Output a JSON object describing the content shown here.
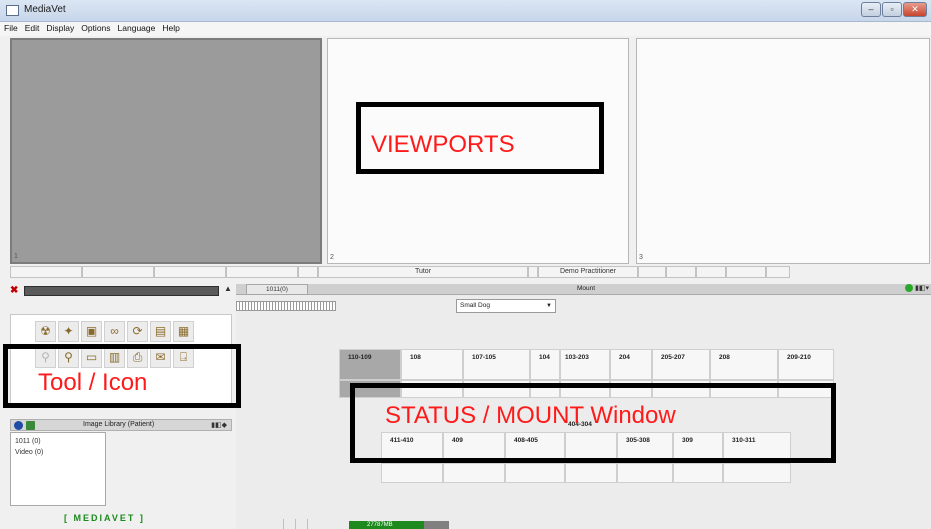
{
  "window": {
    "title": "MediaVet",
    "buttons": {
      "minimize": "–",
      "maximize": "▫",
      "close": "✕"
    }
  },
  "menu": [
    "File",
    "Edit",
    "Display",
    "Options",
    "Language",
    "Help"
  ],
  "viewports": {
    "numbers": [
      "1",
      "2",
      "3"
    ]
  },
  "status_strip": [
    "",
    "",
    "",
    "",
    "",
    "Tutor",
    "",
    "Demo Practitioner",
    "",
    "",
    "",
    "",
    "",
    "",
    ""
  ],
  "tools": {
    "row1": [
      {
        "icon": "radiation-icon",
        "glyph": "☢",
        "enabled": true
      },
      {
        "icon": "wand-icon",
        "glyph": "✦",
        "enabled": true
      },
      {
        "icon": "image-tool-icon",
        "glyph": "▣",
        "enabled": true
      },
      {
        "icon": "link-icon",
        "glyph": "∞",
        "enabled": true
      },
      {
        "icon": "refresh-icon",
        "glyph": "⟳",
        "enabled": true
      },
      {
        "icon": "save-icon",
        "glyph": "▤",
        "enabled": true
      },
      {
        "icon": "layout-icon",
        "glyph": "▦",
        "enabled": true
      }
    ],
    "row2": [
      {
        "icon": "zoom-out-icon",
        "glyph": "⚲",
        "enabled": false
      },
      {
        "icon": "zoom-icon",
        "glyph": "⚲",
        "enabled": true
      },
      {
        "icon": "document-icon",
        "glyph": "▭",
        "enabled": true
      },
      {
        "icon": "print-preview-icon",
        "glyph": "▥",
        "enabled": true
      },
      {
        "icon": "printer-icon",
        "glyph": "⎙",
        "enabled": true
      },
      {
        "icon": "send-icon",
        "glyph": "✉",
        "enabled": true
      },
      {
        "icon": "exit-door-icon",
        "glyph": "⍈",
        "enabled": true
      }
    ]
  },
  "image_library": {
    "title": "Image Library (Patient)",
    "items": [
      "1011 (0)",
      "Video (0)"
    ]
  },
  "logo": "[ MEDIAVET ]",
  "mount": {
    "tab_label": "1011(0)",
    "title": "Mount",
    "species": "Small Dog",
    "top_row": [
      "110-109",
      "108",
      "107-105",
      "104",
      "103-203",
      "204",
      "205-207",
      "208",
      "209-210"
    ],
    "bottom_row": [
      "411-410",
      "409",
      "408-405",
      "404-304",
      "305-308",
      "309",
      "310-311"
    ]
  },
  "memory": {
    "label": "27787MB",
    "fraction": 0.75
  },
  "annotations": {
    "viewports": "VIEWPORTS",
    "tool": "Tool / Icon",
    "status": "STATUS / MOUNT Window"
  },
  "colors": {
    "annotation_text": "#ff1a1a",
    "annotation_border": "#000000",
    "mount_selected": "#a8a8a8",
    "logo": "#1c8a1c"
  }
}
